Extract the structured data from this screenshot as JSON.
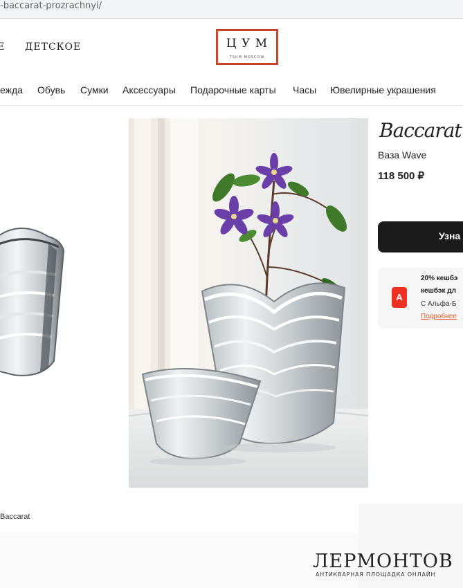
{
  "browser": {
    "url": "-baccarat-prozrachnyi/"
  },
  "header": {
    "gender_nav": [
      "Е",
      "ДЕТСКОЕ"
    ],
    "logo": {
      "letters": "Ц У М",
      "sub": "TSUM MOSCOW"
    }
  },
  "category_nav": [
    "ежда",
    "Обувь",
    "Сумки",
    "Аксессуары",
    "Подарочные карты",
    "Часы",
    "Ювелирные украшения"
  ],
  "product": {
    "brand": "Baccarat",
    "name": "Ваза Wave",
    "price": "118 500 ₽",
    "cta_label": "Узна",
    "caption": "Baccarat"
  },
  "promo": {
    "badge": "А",
    "line1": "20% кешбэ",
    "line2": "кешбэк дл",
    "line3": "С Альфа-Б",
    "link": "Подробнее"
  },
  "watermark": {
    "title": "ЛЕРМОНТОВ",
    "subtitle": "АНТИКВАРНАЯ ПЛОЩАДКА ОНЛАЙН"
  },
  "colors": {
    "logo_border": "#c8452b",
    "cta_bg": "#1b1b1b",
    "alfa_red": "#ef3124",
    "link": "#e2572b"
  }
}
